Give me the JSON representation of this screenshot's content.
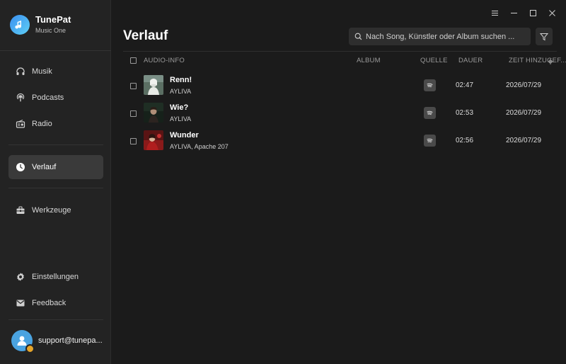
{
  "app": {
    "name": "TunePat",
    "subtitle": "Music One"
  },
  "sidebar": {
    "items": [
      {
        "label": "Musik",
        "icon": "headphones-icon"
      },
      {
        "label": "Podcasts",
        "icon": "podcast-icon"
      },
      {
        "label": "Radio",
        "icon": "radio-icon"
      },
      {
        "label": "Verlauf",
        "icon": "clock-icon",
        "active": true
      },
      {
        "label": "Werkzeuge",
        "icon": "toolbox-icon"
      },
      {
        "label": "Einstellungen",
        "icon": "gear-icon"
      },
      {
        "label": "Feedback",
        "icon": "mail-icon"
      }
    ],
    "account_email": "support@tunepa..."
  },
  "main": {
    "title": "Verlauf",
    "search_placeholder": "Nach Song, Künstler oder Album suchen ...",
    "columns": {
      "audio_info": "AUDIO-INFO",
      "album": "ALBUM",
      "source": "QUELLE",
      "duration": "DAUER",
      "added": "ZEIT HINZUGEF..."
    },
    "rows": [
      {
        "title": "Renn!",
        "artist": "AYLIVA",
        "album": "",
        "source": "spotify-icon",
        "duration": "02:47",
        "added": "2026/07/29"
      },
      {
        "title": "Wie?",
        "artist": "AYLIVA",
        "album": "",
        "source": "spotify-icon",
        "duration": "02:53",
        "added": "2026/07/29"
      },
      {
        "title": "Wunder",
        "artist": "AYLIVA, Apache 207",
        "album": "",
        "source": "spotify-icon",
        "duration": "02:56",
        "added": "2026/07/29"
      }
    ]
  },
  "colors": {
    "background": "#1b1b1b",
    "sidebar": "#232323",
    "active_item": "#3a3a3a",
    "accent": "#3a8ff0"
  }
}
